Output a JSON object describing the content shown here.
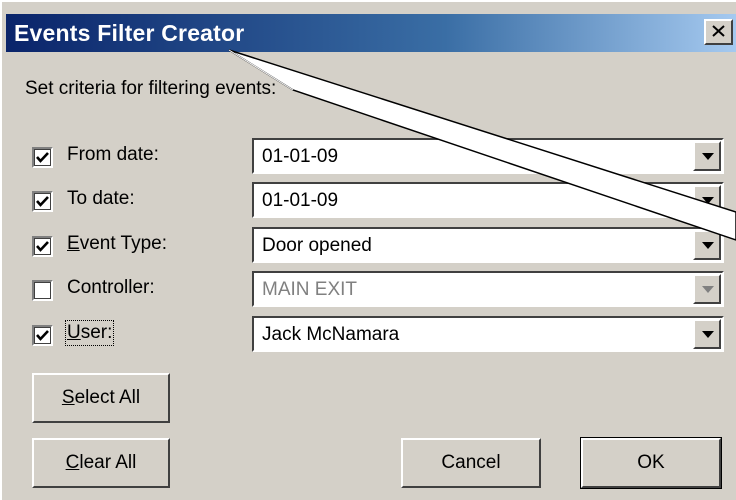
{
  "window": {
    "title": "Events Filter Creator"
  },
  "instructions": "Set criteria for filtering events:",
  "criteria": [
    {
      "label_prefix": "",
      "label_mnemonic": "",
      "label_rest": "From date:",
      "checked": true,
      "value": "01-01-09",
      "enabled": true
    },
    {
      "label_prefix": "",
      "label_mnemonic": "",
      "label_rest": "To date:",
      "checked": true,
      "value": "01-01-09",
      "enabled": true
    },
    {
      "label_prefix": "",
      "label_mnemonic": "E",
      "label_rest": "vent Type:",
      "checked": true,
      "value": "Door opened",
      "enabled": true
    },
    {
      "label_prefix": "",
      "label_mnemonic": "",
      "label_rest": "Controller:",
      "checked": false,
      "value": "MAIN EXIT",
      "enabled": false
    },
    {
      "label_prefix": "",
      "label_mnemonic": "U",
      "label_rest": "ser:",
      "checked": true,
      "value": "Jack McNamara",
      "enabled": true
    }
  ],
  "buttons": {
    "select_all_mnemonic": "S",
    "select_all_rest": "elect All",
    "clear_all_mnemonic": "C",
    "clear_all_rest": "lear All",
    "cancel": "Cancel",
    "ok": "OK"
  },
  "icons": {
    "close": "close-icon",
    "dropdown": "chevron-down-icon",
    "check": "check-icon"
  },
  "colors": {
    "titlebar_start": "#0a246a",
    "titlebar_end": "#a6caf0",
    "face": "#d4d0c8"
  }
}
